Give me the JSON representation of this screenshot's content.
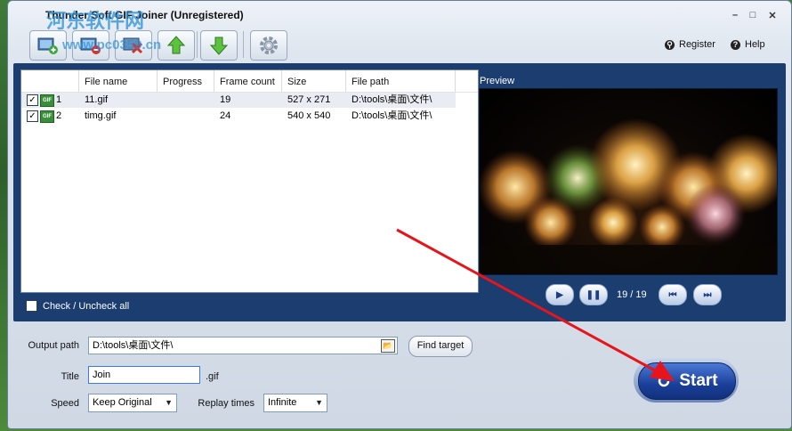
{
  "window": {
    "title": "Thunder Soft GIF Joiner (Unregistered)"
  },
  "watermark": {
    "site_cn": "河东软件网",
    "site_url": "www.pc0359.cn"
  },
  "toolbar": {
    "buttons": [
      "add-gif-icon",
      "remove-gif-icon",
      "clear-list-icon",
      "move-up-icon",
      "move-down-icon",
      "settings-icon"
    ],
    "register_label": "Register",
    "help_label": "Help"
  },
  "file_list": {
    "columns": [
      "",
      "File name",
      "Progress",
      "Frame count",
      "Size",
      "File path"
    ],
    "rows": [
      {
        "index": "1",
        "checked": true,
        "name": "11.gif",
        "progress": "",
        "frames": "19",
        "size": "527 x 271",
        "path": "D:\\tools\\桌面\\文件\\"
      },
      {
        "index": "2",
        "checked": true,
        "name": "timg.gif",
        "progress": "",
        "frames": "24",
        "size": "540 x 540",
        "path": "D:\\tools\\桌面\\文件\\"
      }
    ],
    "check_all_label": "Check / Uncheck all"
  },
  "preview": {
    "label": "Preview",
    "frame_counter": "19 / 19"
  },
  "output": {
    "output_path_label": "Output path",
    "output_path_value": "D:\\tools\\桌面\\文件\\",
    "find_target_label": "Find target",
    "title_label": "Title",
    "title_value": "Join",
    "title_ext": ".gif",
    "speed_label": "Speed",
    "speed_value": "Keep Original",
    "replay_label": "Replay times",
    "replay_value": "Infinite"
  },
  "start_button": {
    "label": "Start"
  },
  "colors": {
    "panel_blue": "#1c3d70",
    "start_blue": "#1b3f99",
    "annotation_red": "#e8141b"
  }
}
